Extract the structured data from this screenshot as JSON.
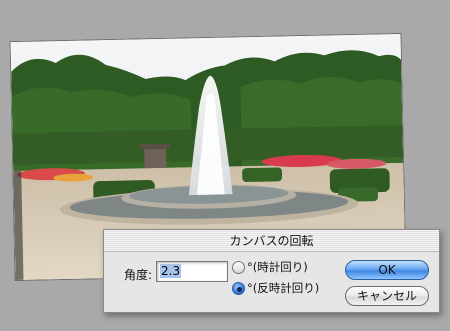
{
  "dialog": {
    "title": "カンバスの回転",
    "angle_label": "角度:",
    "angle_value": "2.3",
    "radio_cw": "°(時計回り)",
    "radio_ccw": "°(反時計回り)",
    "selected_direction": "ccw",
    "ok_label": "OK",
    "cancel_label": "キャンセル"
  },
  "colors": {
    "background": "#a9a9a9",
    "ok_button": "#3f86e4",
    "dialog_bg": "#e6e6e6"
  }
}
